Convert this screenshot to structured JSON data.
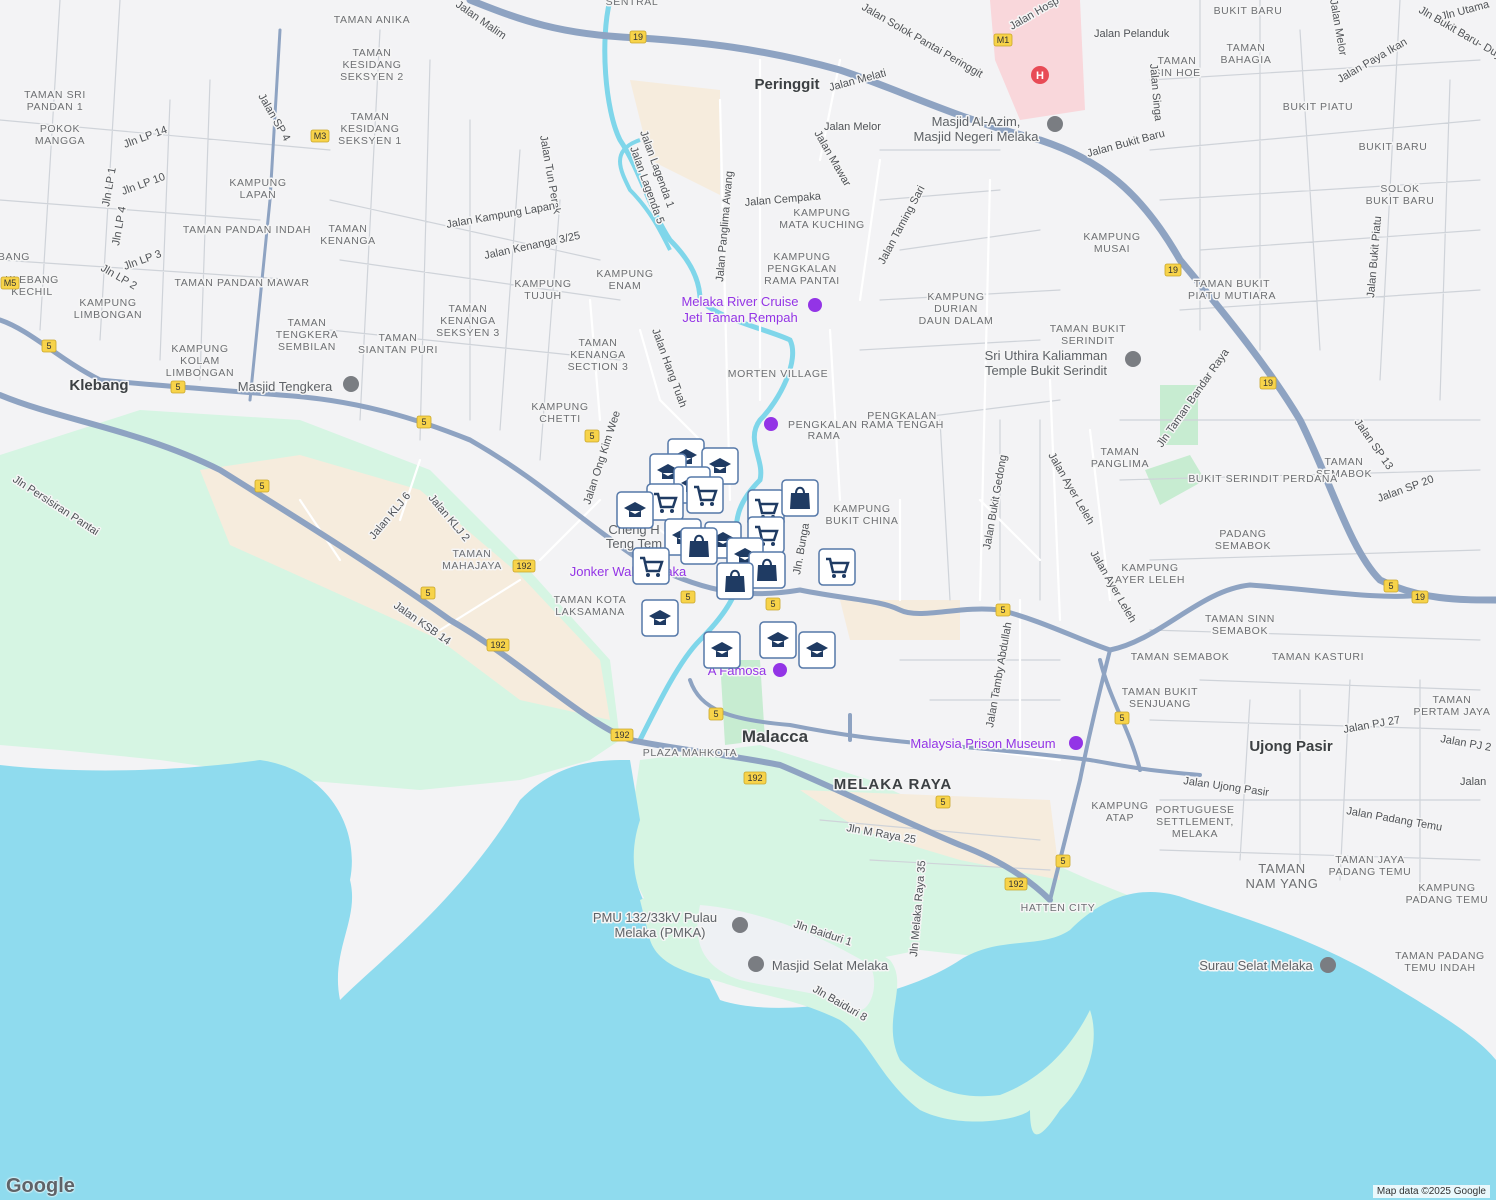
{
  "map": {
    "colors": {
      "land": "#f3f3f5",
      "sea": "#8fdbee",
      "reclaimed_green": "#d6f5e3",
      "sand": "#f6ecdd",
      "highway": "#8ea3c2",
      "hospital_zone": "#f9d7db",
      "river": "#7fd6ea",
      "park": "#c7ecd1",
      "poi_purple": "#9334e6"
    },
    "towns": {
      "malacca": "Malacca",
      "peringgit": "Peringgit",
      "klebang": "Klebang",
      "ujong_pasir": "Ujong Pasir",
      "melaka_raya": "MELAKA RAYA"
    },
    "areas": {
      "taman_anika": "TAMAN ANIKA",
      "taman_kesidang_2a": "TAMAN",
      "taman_kesidang_2b": "KESIDANG",
      "taman_kesidang_2c": "SEKSYEN 2",
      "taman_kesidang_1a": "TAMAN",
      "taman_kesidang_1b": "KESIDANG",
      "taman_kesidang_1c": "SEKSYEN 1",
      "taman_sri_pandan_a": "TAMAN SRI",
      "taman_sri_pandan_b": "PANDAN 1",
      "pokok_mangga_a": "POKOK",
      "pokok_mangga_b": "MANGGA",
      "kampung_lapan_a": "KAMPUNG",
      "kampung_lapan_b": "LAPAN",
      "taman_pandan_indah": "TAMAN PANDAN INDAH",
      "taman_kenanga_a": "TAMAN",
      "taman_kenanga_b": "KENANGA",
      "taman_pandan_mawar": "TAMAN PANDAN MAWAR",
      "klebang_kechil_a": "KLEBANG",
      "klebang_kechil_b": "KECHIL",
      "kampung_limbongan_a": "KAMPUNG",
      "kampung_limbongan_b": "LIMBONGAN",
      "kampung_kolam_a": "KAMPUNG",
      "kampung_kolam_b": "KOLAM",
      "kampung_kolam_c": "LIMBONGAN",
      "taman_tengkera_a": "TAMAN",
      "taman_tengkera_b": "TENGKERA",
      "taman_tengkera_c": "SEMBILAN",
      "taman_kenanga_s3_a": "TAMAN",
      "taman_kenanga_s3_b": "KENANGA",
      "taman_kenanga_s3_c": "SEKSYEN 3",
      "taman_siantan_a": "TAMAN",
      "taman_siantan_b": "SIANTAN PURI",
      "kampung_tujuh_a": "KAMPUNG",
      "kampung_tujuh_b": "TUJUH",
      "kampung_enam_a": "KAMPUNG",
      "kampung_enam_b": "ENAM",
      "taman_kenanga_sec3_a": "TAMAN",
      "taman_kenanga_sec3_b": "KENANGA",
      "taman_kenanga_sec3_c": "SECTION 3",
      "kampung_chetti_a": "KAMPUNG",
      "kampung_chetti_b": "CHETTI",
      "taman_mahajaya_a": "TAMAN",
      "taman_mahajaya_b": "MAHAJAYA",
      "taman_kota_laksamana_a": "TAMAN KOTA",
      "taman_kota_laksamana_b": "LAKSAMANA",
      "plaza_mahkota": "PLAZA MAHKOTA",
      "kampung_mata_kuching_a": "KAMPUNG",
      "kampung_mata_kuching_b": "MATA KUCHING",
      "kampung_pengkalan_a": "KAMPUNG",
      "kampung_pengkalan_b": "PENGKALAN",
      "kampung_pengkalan_c": "RAMA PANTAI",
      "morten_village": "MORTEN VILLAGE",
      "pengkalan_rama_a": "PENGKALAN",
      "pengkalan_rama_b": "RAMA",
      "pengkalan_rama_tengah": "PENGKALAN RAMA TENGAH",
      "kampung_bukit_china_a": "KAMPUNG",
      "kampung_bukit_china_b": "BUKIT CHINA",
      "kampung_durian_a": "KAMPUNG",
      "kampung_durian_b": "DURIAN",
      "kampung_durian_c": "DAUN DALAM",
      "taman_bukit_serindit_a": "TAMAN BUKIT",
      "taman_bukit_serindit_b": "SERINDIT",
      "taman_panglima_a": "TAMAN",
      "taman_panglima_b": "PANGLIMA",
      "taman_bahagia_a": "TAMAN",
      "taman_bahagia_b": "BAHAGIA",
      "bukit_baru": "BUKIT BARU",
      "taman_sin_hoe_a": "TAMAN",
      "taman_sin_hoe_b": "SIN HOE",
      "bukit_piatu": "BUKIT PIATU",
      "bukit_baru_2": "BUKIT BARU",
      "solok_bukit_baru_a": "SOLOK",
      "solok_bukit_baru_b": "BUKIT BARU",
      "kampung_musai_a": "KAMPUNG",
      "kampung_musai_b": "MUSAI",
      "taman_bukit_piatu_a": "TAMAN BUKIT",
      "taman_bukit_piatu_b": "PIATU MUTIARA",
      "taman_semabok_perdana_a": "TAMAN",
      "taman_semabok_perdana_b": "SEMABOK",
      "bukit_serindit_perdana": "BUKIT SERINDIT PERDANA",
      "padang_semabok_a": "PADANG",
      "padang_semabok_b": "SEMABOK",
      "kampung_ayer_leleh_a": "KAMPUNG",
      "kampung_ayer_leleh_b": "AYER LELEH",
      "taman_sinn_semabok_a": "TAMAN SINN",
      "taman_sinn_semabok_b": "SEMABOK",
      "taman_semabok": "TAMAN SEMABOK",
      "taman_kasturi": "TAMAN KASTURI",
      "taman_bukit_senjuang_a": "TAMAN BUKIT",
      "taman_bukit_senjuang_b": "SENJUANG",
      "taman_pertam_jaya_a": "TAMAN",
      "taman_pertam_jaya_b": "PERTAM JAYA",
      "kampung_atap_a": "KAMPUNG",
      "kampung_atap_b": "ATAP",
      "portuguese_a": "PORTUGUESE",
      "portuguese_b": "SETTLEMENT,",
      "portuguese_c": "MELAKA",
      "taman_nam_yang_a": "TAMAN",
      "taman_nam_yang_b": "NAM YANG",
      "taman_jaya_padang_a": "TAMAN JAYA",
      "taman_jaya_padang_b": "PADANG TEMU",
      "kampung_padang_temu_a": "KAMPUNG",
      "kampung_padang_temu_b": "PADANG TEMU",
      "taman_padang_temu_indah_a": "TAMAN PADANG",
      "taman_padang_temu_indah_b": "TEMU INDAH",
      "hatten_city": "HATTEN CITY",
      "sentral": "SENTRAL"
    },
    "streets": {
      "jalan_malim": "Jalan Malim",
      "jalan_tun_perak": "Jalan Tun Perak",
      "jalan_kampung_lapan": "Jalan Kampung Lapan",
      "jalan_kenanga": "Jalan Kenanga 3/25",
      "jalan_sp4": "Jalan SP 4",
      "jln_lp14": "Jln LP 14",
      "jln_lp1": "Jln LP 1",
      "jln_lp10": "Jln LP 10",
      "jln_lp4": "Jln LP 4",
      "jln_lp3": "Jln LP 3",
      "jln_lp2": "Jln LP 2",
      "bang": "BANG",
      "jln_persisiran": "Jln Persisiran Pantai",
      "jalan_klj6": "Jalan KLJ 6",
      "jalan_klj2": "Jalan KLJ 2",
      "jalan_ksb14": "Jalan KSB 14",
      "jalan_ong_kim_wee": "Jalan Ong Kim Wee",
      "jalan_hang_tuah": "Jalan Hang Tuah",
      "jalan_lagenda1": "Jalan Lagenda 1",
      "jalan_lagenda5": "Jalan Lagenda 5",
      "jalan_panglima_awang": "Jalan Panglima Awang",
      "jalan_melati": "Jalan Melati",
      "jalan_melor": "Jalan Melor",
      "jalan_mawar": "Jalan Mawar",
      "jalan_cempaka": "Jalan Cempaka",
      "jalan_taming_sari": "Jalan Taming Sari",
      "jalan_solok": "Jalan Solok Pantai Peringgit",
      "jalan_hospital": "Jalan Hosp",
      "jalan_pelanduk": "Jalan Pelanduk",
      "jalan_singa": "Jalan Singa",
      "jalan_bukit_baru": "Jalan Bukit Baru",
      "jalan_melor_2": "Jalan Melor",
      "jln_utama": "Jln Utama",
      "jalan_paya_ikan": "Jalan Paya Ikan",
      "jln_bukit_baru_duyong": "Jln Bukit Baru- Duyong",
      "jalan_bukit_piatu": "Jalan Bukit Piatu",
      "jln_taman_bandar_raya": "Jln Taman Bandar Raya",
      "jalan_sp13": "Jalan SP 13",
      "jalan_sp20": "Jalan SP 20",
      "jalan_bukit_gedong": "Jalan Bukit Gedong",
      "jalan_ayer_leleh": "Jalan Ayer Leleh",
      "jalan_ayer_leleh_2": "Jalan Ayer Leleh",
      "jln_bunga": "Jln. Bunga",
      "jalan_tamby": "Jalan Tamby Abdullah",
      "jalan_ujong_pasir": "Jalan Ujong Pasir",
      "jalan_padang_temu": "Jalan Padang Temu",
      "jalan_pj27": "Jalan PJ 27",
      "jalan_pj2": "Jalan PJ 2",
      "jalan_cut": "Jalan",
      "jln_m_raya_25": "Jln M Raya 25",
      "jln_melaka_raya_35": "Jln Melaka Raya 35",
      "jln_baiduri_1": "Jln Baiduri 1",
      "jln_baiduri_8": "Jln Baiduri 8"
    },
    "pois": {
      "river_cruise_a": "Melaka River Cruise",
      "river_cruise_b": "Jeti Taman Rempah",
      "jonker_walk": "Jonker Walk Melaka",
      "a_famosa": "A Famosa",
      "prison_museum": "Malaysia Prison Museum",
      "masjid_tengkera": "Masjid Tengkera",
      "masjid_al_azim_a": "Masjid Al-Azim,",
      "masjid_al_azim_b": "Masjid Negeri Melaka",
      "sri_uthira_a": "Sri Uthira Kaliamman",
      "sri_uthira_b": "Temple Bukit Serindit",
      "cheng_hoon_a": "Cheng H",
      "cheng_hoon_b": "Teng Tem",
      "pmu_a": "PMU 132/33kV Pulau",
      "pmu_b": "Melaka (PMKA)",
      "masjid_selat": "Masjid Selat Melaka",
      "surau_selat": "Surau Selat Melaka"
    },
    "route_shields": [
      "19",
      "M1",
      "M3",
      "M5",
      "5",
      "192"
    ],
    "markers": {
      "school": "school-icon",
      "shopping_cart": "shopping-cart-icon",
      "shopping_bag": "shopping-bag-icon"
    }
  },
  "attribution": {
    "logo": "Google",
    "text": "Map data ©2025 Google"
  }
}
